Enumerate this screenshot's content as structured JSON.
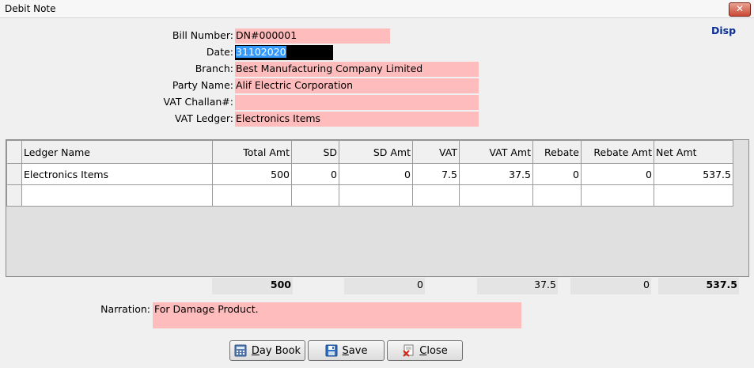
{
  "window": {
    "title": "Debit Note",
    "close_glyph": "✕"
  },
  "disp_label": "Disp",
  "form": {
    "bill_number": {
      "label": "Bill Number:",
      "value": "DN#000001"
    },
    "date": {
      "label": "Date:",
      "value": "31102020"
    },
    "branch": {
      "label": "Branch:",
      "value": "Best Manufacturing Company Limited"
    },
    "party_name": {
      "label": "Party Name:",
      "value": "Alif Electric Corporation"
    },
    "vat_challan": {
      "label": "VAT Challan#:",
      "value": ""
    },
    "vat_ledger": {
      "label": "VAT Ledger:",
      "value": "Electronics Items"
    }
  },
  "grid": {
    "columns": [
      "Ledger Name",
      "Total Amt",
      "SD",
      "SD Amt",
      "VAT",
      "VAT Amt",
      "Rebate",
      "Rebate Amt",
      "Net Amt"
    ],
    "rows": [
      [
        "Electronics Items",
        "500",
        "0",
        "0",
        "7.5",
        "37.5",
        "0",
        "0",
        "537.5"
      ],
      [
        "",
        "",
        "",
        "",
        "",
        "",
        "",
        "",
        ""
      ]
    ]
  },
  "totals": {
    "total_amt": "500",
    "sd_amt": "0",
    "vat_amt": "37.5",
    "rebate_amt": "0",
    "net_amt": "537.5"
  },
  "narration": {
    "label": "Narration:",
    "value": "For Damage Product."
  },
  "buttons": {
    "day_book": {
      "label_prefix": "D",
      "label_rest": "ay Book",
      "icon": "calculator-icon"
    },
    "save": {
      "label_prefix": "S",
      "label_rest": "ave",
      "icon": "floppy-disk-icon"
    },
    "close": {
      "label_prefix": "C",
      "label_rest": "lose",
      "icon": "close-document-icon"
    }
  },
  "colors": {
    "field_bg": "#ffbcbc",
    "accent": "#0b2e93",
    "selection": "#3399ff"
  }
}
